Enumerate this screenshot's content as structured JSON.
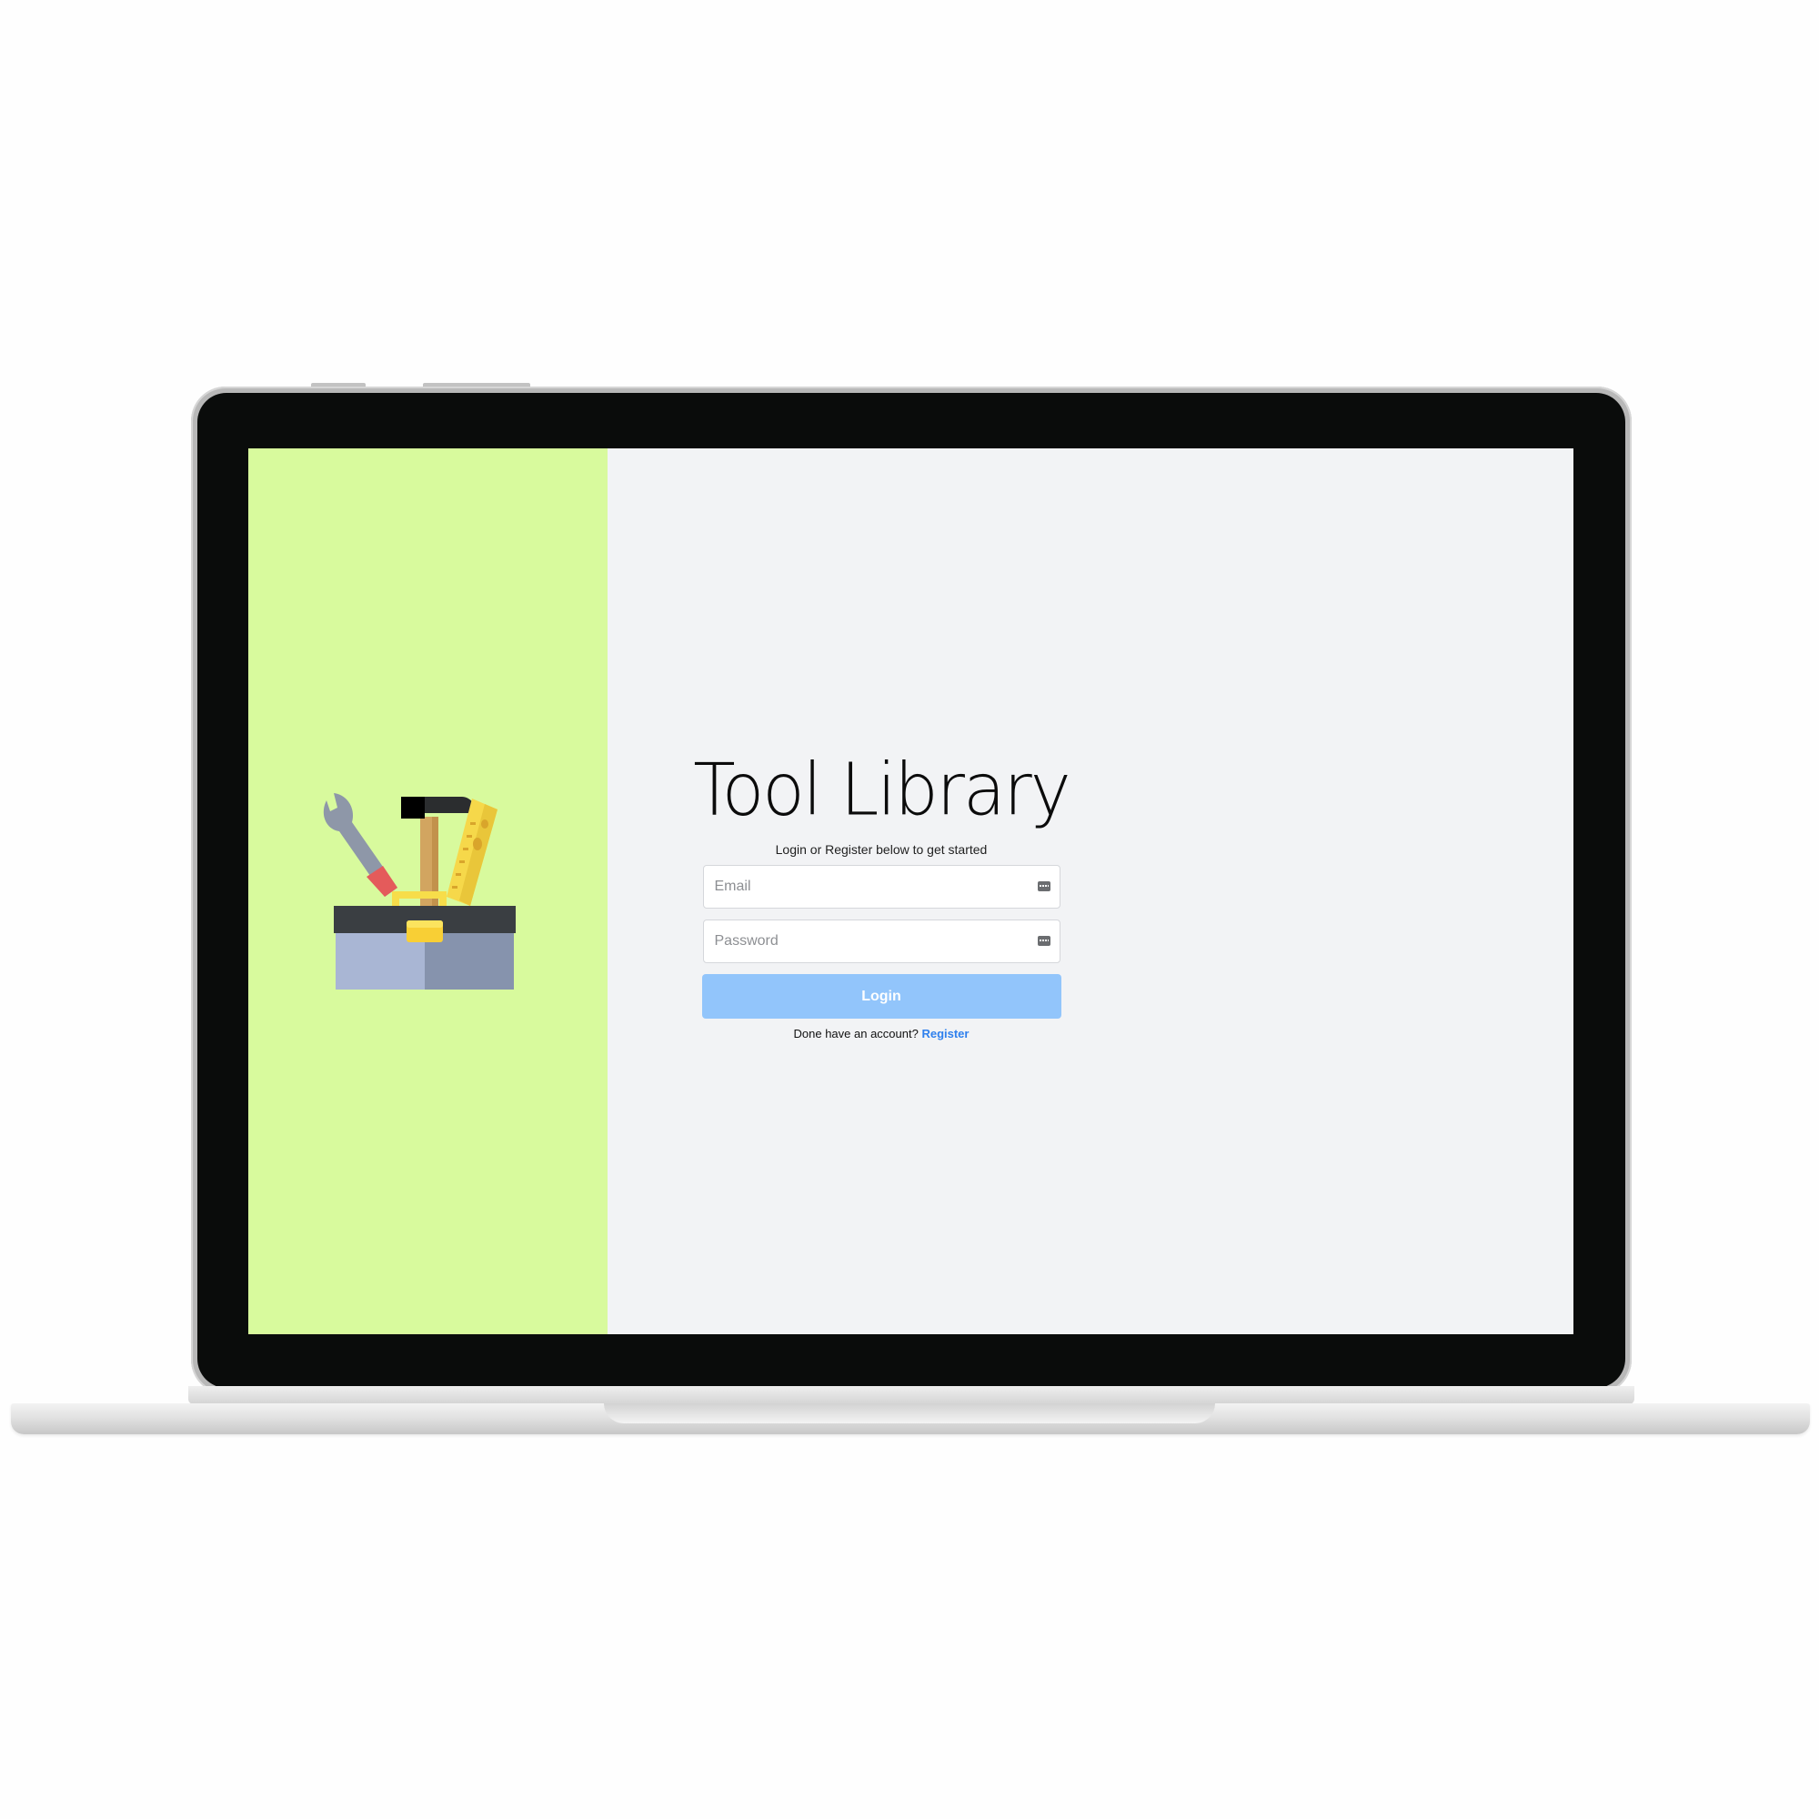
{
  "app": {
    "title": "Tool Library",
    "subtitle": "Login or Register below to get started"
  },
  "form": {
    "email": {
      "value": "",
      "placeholder": "Email",
      "icon": "password-manager-icon"
    },
    "password": {
      "value": "",
      "placeholder": "Password",
      "icon": "password-manager-icon"
    },
    "login_label": "Login",
    "register_prompt": "Done have an account?",
    "register_link_label": "Register"
  },
  "colors": {
    "left_panel": "#d8fa9d",
    "right_panel": "#f2f3f5",
    "login_button": "#92c5fb",
    "link": "#2f80ed"
  },
  "illustration": {
    "icon": "toolbox-icon"
  }
}
